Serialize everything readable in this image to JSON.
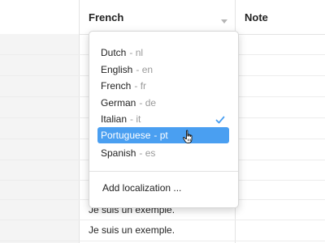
{
  "header": {
    "columns": [
      {
        "label": ""
      },
      {
        "label": "French"
      },
      {
        "label": "Note"
      }
    ]
  },
  "table": {
    "visible_cells": [
      "Je suis un exemple.",
      "Je suis un exemple."
    ]
  },
  "language_menu": {
    "items": [
      {
        "name": "Dutch",
        "code": "- nl",
        "checked": false,
        "highlighted": false
      },
      {
        "name": "English",
        "code": "- en",
        "checked": false,
        "highlighted": false
      },
      {
        "name": "French",
        "code": "- fr",
        "checked": true,
        "highlighted": false
      },
      {
        "name": "German",
        "code": "- de",
        "checked": false,
        "highlighted": false
      },
      {
        "name": "Italian",
        "code": "- it",
        "checked": false,
        "highlighted": false
      },
      {
        "name": "Portuguese",
        "code": "- pt",
        "checked": false,
        "highlighted": true
      },
      {
        "name": "Spanish",
        "code": "- es",
        "checked": false,
        "highlighted": false
      }
    ],
    "add_label": "Add localization ..."
  },
  "colors": {
    "highlight": "#4a9ff1",
    "check": "#4a9ff1",
    "muted_code": "#9a9a9a"
  },
  "icons": {
    "column_caret": "chevron-down-icon",
    "selected_mark": "checkmark-icon",
    "pointer": "hand-pointer-icon"
  }
}
